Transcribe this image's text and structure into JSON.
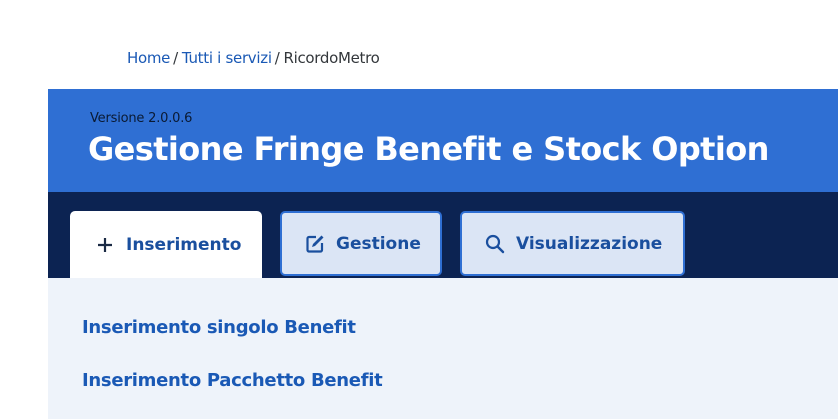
{
  "breadcrumb": {
    "items": [
      "Home",
      "Tutti i servizi"
    ],
    "separator": "/",
    "current": "RicordoMetro"
  },
  "header": {
    "version": "Versione 2.0.0.6",
    "title": "Gestione Fringe Benefit e Stock Option"
  },
  "tabs": [
    {
      "label": "Inserimento",
      "icon": "plus-icon",
      "active": true
    },
    {
      "label": "Gestione",
      "icon": "edit-icon",
      "active": false
    },
    {
      "label": "Visualizzazione",
      "icon": "search-icon",
      "active": false
    }
  ],
  "content": {
    "links": [
      "Inserimento singolo Benefit",
      "Inserimento Pacchetto Benefit"
    ]
  },
  "colors": {
    "header_bg": "#2f6fd3",
    "tabbar_bg": "#0c2352",
    "link": "#1a59b5",
    "content_bg": "#eef3fa"
  }
}
